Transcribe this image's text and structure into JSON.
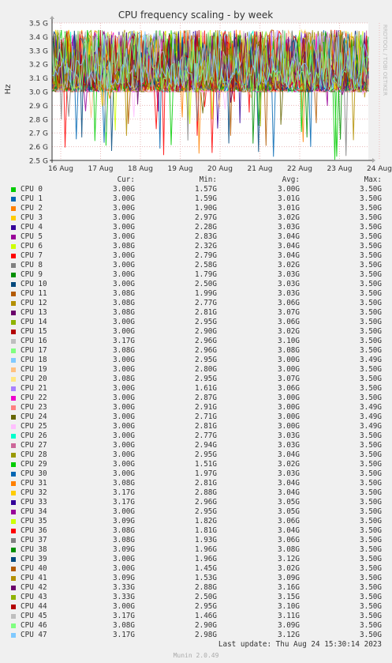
{
  "chart_data": {
    "type": "line",
    "title": "CPU frequency scaling - by week",
    "ylabel": "Hz",
    "side_label": "RRDTOOL / TOBI OETIKER",
    "ylim": [
      2.5,
      3.5
    ],
    "y_ticks": [
      {
        "v": 3.5,
        "label": "3.5 G"
      },
      {
        "v": 3.4,
        "label": "3.4 G"
      },
      {
        "v": 3.3,
        "label": "3.3 G"
      },
      {
        "v": 3.2,
        "label": "3.2 G"
      },
      {
        "v": 3.1,
        "label": "3.1 G"
      },
      {
        "v": 3.0,
        "label": "3.0 G"
      },
      {
        "v": 2.9,
        "label": "2.9 G"
      },
      {
        "v": 2.8,
        "label": "2.8 G"
      },
      {
        "v": 2.7,
        "label": "2.7 G"
      },
      {
        "v": 2.6,
        "label": "2.6 G"
      },
      {
        "v": 2.5,
        "label": "2.5 G"
      }
    ],
    "x_ticks": [
      "16 Aug",
      "17 Aug",
      "18 Aug",
      "19 Aug",
      "20 Aug",
      "21 Aug",
      "22 Aug",
      "23 Aug",
      "24 Aug"
    ],
    "grid": true,
    "columns": [
      "Cur:",
      "Min:",
      "Avg:",
      "Max:"
    ],
    "series": [
      {
        "name": "CPU 0",
        "color": "#00cc00",
        "cur": "3.00G",
        "min": "1.57G",
        "avg": "3.00G",
        "max": "3.50G"
      },
      {
        "name": "CPU 1",
        "color": "#0066b3",
        "cur": "3.00G",
        "min": "1.59G",
        "avg": "3.01G",
        "max": "3.50G"
      },
      {
        "name": "CPU 2",
        "color": "#ff8000",
        "cur": "3.00G",
        "min": "1.90G",
        "avg": "3.01G",
        "max": "3.50G"
      },
      {
        "name": "CPU 3",
        "color": "#ffcc00",
        "cur": "3.00G",
        "min": "2.97G",
        "avg": "3.02G",
        "max": "3.50G"
      },
      {
        "name": "CPU 4",
        "color": "#330099",
        "cur": "3.00G",
        "min": "2.28G",
        "avg": "3.03G",
        "max": "3.50G"
      },
      {
        "name": "CPU 5",
        "color": "#990099",
        "cur": "3.00G",
        "min": "2.83G",
        "avg": "3.04G",
        "max": "3.50G"
      },
      {
        "name": "CPU 6",
        "color": "#ccff00",
        "cur": "3.08G",
        "min": "2.32G",
        "avg": "3.04G",
        "max": "3.50G"
      },
      {
        "name": "CPU 7",
        "color": "#ff0000",
        "cur": "3.00G",
        "min": "2.79G",
        "avg": "3.04G",
        "max": "3.50G"
      },
      {
        "name": "CPU 8",
        "color": "#808080",
        "cur": "3.00G",
        "min": "2.58G",
        "avg": "3.02G",
        "max": "3.50G"
      },
      {
        "name": "CPU 9",
        "color": "#008f00",
        "cur": "3.00G",
        "min": "1.79G",
        "avg": "3.03G",
        "max": "3.50G"
      },
      {
        "name": "CPU 10",
        "color": "#00487d",
        "cur": "3.00G",
        "min": "2.50G",
        "avg": "3.03G",
        "max": "3.50G"
      },
      {
        "name": "CPU 11",
        "color": "#b35a00",
        "cur": "3.08G",
        "min": "1.99G",
        "avg": "3.03G",
        "max": "3.50G"
      },
      {
        "name": "CPU 12",
        "color": "#b38f00",
        "cur": "3.08G",
        "min": "2.77G",
        "avg": "3.06G",
        "max": "3.50G"
      },
      {
        "name": "CPU 13",
        "color": "#6b006b",
        "cur": "3.08G",
        "min": "2.81G",
        "avg": "3.07G",
        "max": "3.50G"
      },
      {
        "name": "CPU 14",
        "color": "#8fb300",
        "cur": "3.00G",
        "min": "2.95G",
        "avg": "3.06G",
        "max": "3.50G"
      },
      {
        "name": "CPU 15",
        "color": "#b30000",
        "cur": "3.00G",
        "min": "2.90G",
        "avg": "3.02G",
        "max": "3.50G"
      },
      {
        "name": "CPU 16",
        "color": "#bebebe",
        "cur": "3.17G",
        "min": "2.96G",
        "avg": "3.10G",
        "max": "3.50G"
      },
      {
        "name": "CPU 17",
        "color": "#80ff80",
        "cur": "3.08G",
        "min": "2.96G",
        "avg": "3.08G",
        "max": "3.50G"
      },
      {
        "name": "CPU 18",
        "color": "#80c9ff",
        "cur": "3.00G",
        "min": "2.95G",
        "avg": "3.00G",
        "max": "3.49G"
      },
      {
        "name": "CPU 19",
        "color": "#ffc080",
        "cur": "3.00G",
        "min": "2.80G",
        "avg": "3.00G",
        "max": "3.50G"
      },
      {
        "name": "CPU 20",
        "color": "#ffe680",
        "cur": "3.08G",
        "min": "2.95G",
        "avg": "3.07G",
        "max": "3.50G"
      },
      {
        "name": "CPU 21",
        "color": "#aa80ff",
        "cur": "3.00G",
        "min": "1.61G",
        "avg": "3.06G",
        "max": "3.50G"
      },
      {
        "name": "CPU 22",
        "color": "#ee00cc",
        "cur": "3.00G",
        "min": "2.87G",
        "avg": "3.00G",
        "max": "3.50G"
      },
      {
        "name": "CPU 23",
        "color": "#ff8080",
        "cur": "3.00G",
        "min": "2.91G",
        "avg": "3.00G",
        "max": "3.49G"
      },
      {
        "name": "CPU 24",
        "color": "#666600",
        "cur": "3.00G",
        "min": "2.71G",
        "avg": "3.00G",
        "max": "3.49G"
      },
      {
        "name": "CPU 25",
        "color": "#ffbfff",
        "cur": "3.00G",
        "min": "2.81G",
        "avg": "3.00G",
        "max": "3.49G"
      },
      {
        "name": "CPU 26",
        "color": "#00ffcc",
        "cur": "3.00G",
        "min": "2.77G",
        "avg": "3.03G",
        "max": "3.50G"
      },
      {
        "name": "CPU 27",
        "color": "#cc6699",
        "cur": "3.00G",
        "min": "2.94G",
        "avg": "3.03G",
        "max": "3.50G"
      },
      {
        "name": "CPU 28",
        "color": "#999900",
        "cur": "3.00G",
        "min": "2.95G",
        "avg": "3.04G",
        "max": "3.50G"
      },
      {
        "name": "CPU 29",
        "color": "#00cc00",
        "cur": "3.00G",
        "min": "1.51G",
        "avg": "3.02G",
        "max": "3.50G"
      },
      {
        "name": "CPU 30",
        "color": "#0066b3",
        "cur": "3.00G",
        "min": "1.97G",
        "avg": "3.03G",
        "max": "3.50G"
      },
      {
        "name": "CPU 31",
        "color": "#ff8000",
        "cur": "3.08G",
        "min": "2.81G",
        "avg": "3.04G",
        "max": "3.50G"
      },
      {
        "name": "CPU 32",
        "color": "#ffcc00",
        "cur": "3.17G",
        "min": "2.88G",
        "avg": "3.04G",
        "max": "3.50G"
      },
      {
        "name": "CPU 33",
        "color": "#330099",
        "cur": "3.17G",
        "min": "2.96G",
        "avg": "3.05G",
        "max": "3.50G"
      },
      {
        "name": "CPU 34",
        "color": "#990099",
        "cur": "3.00G",
        "min": "2.95G",
        "avg": "3.05G",
        "max": "3.50G"
      },
      {
        "name": "CPU 35",
        "color": "#ccff00",
        "cur": "3.09G",
        "min": "1.82G",
        "avg": "3.06G",
        "max": "3.50G"
      },
      {
        "name": "CPU 36",
        "color": "#ff0000",
        "cur": "3.08G",
        "min": "1.81G",
        "avg": "3.04G",
        "max": "3.50G"
      },
      {
        "name": "CPU 37",
        "color": "#808080",
        "cur": "3.08G",
        "min": "1.93G",
        "avg": "3.06G",
        "max": "3.50G"
      },
      {
        "name": "CPU 38",
        "color": "#008f00",
        "cur": "3.09G",
        "min": "1.96G",
        "avg": "3.08G",
        "max": "3.50G"
      },
      {
        "name": "CPU 39",
        "color": "#00487d",
        "cur": "3.00G",
        "min": "1.96G",
        "avg": "3.12G",
        "max": "3.50G"
      },
      {
        "name": "CPU 40",
        "color": "#b35a00",
        "cur": "3.00G",
        "min": "1.45G",
        "avg": "3.02G",
        "max": "3.50G"
      },
      {
        "name": "CPU 41",
        "color": "#b38f00",
        "cur": "3.09G",
        "min": "1.53G",
        "avg": "3.09G",
        "max": "3.50G"
      },
      {
        "name": "CPU 42",
        "color": "#6b006b",
        "cur": "3.33G",
        "min": "2.88G",
        "avg": "3.16G",
        "max": "3.50G"
      },
      {
        "name": "CPU 43",
        "color": "#8fb300",
        "cur": "3.33G",
        "min": "2.50G",
        "avg": "3.15G",
        "max": "3.50G"
      },
      {
        "name": "CPU 44",
        "color": "#b30000",
        "cur": "3.00G",
        "min": "2.95G",
        "avg": "3.10G",
        "max": "3.50G"
      },
      {
        "name": "CPU 45",
        "color": "#bebebe",
        "cur": "3.17G",
        "min": "1.46G",
        "avg": "3.11G",
        "max": "3.50G"
      },
      {
        "name": "CPU 46",
        "color": "#80ff80",
        "cur": "3.08G",
        "min": "2.90G",
        "avg": "3.09G",
        "max": "3.50G"
      },
      {
        "name": "CPU 47",
        "color": "#80c9ff",
        "cur": "3.17G",
        "min": "2.98G",
        "avg": "3.12G",
        "max": "3.50G"
      }
    ]
  },
  "footer": {
    "last_update": "Last update: Thu Aug 24 15:30:14 2023",
    "version": "Munin 2.0.49"
  }
}
